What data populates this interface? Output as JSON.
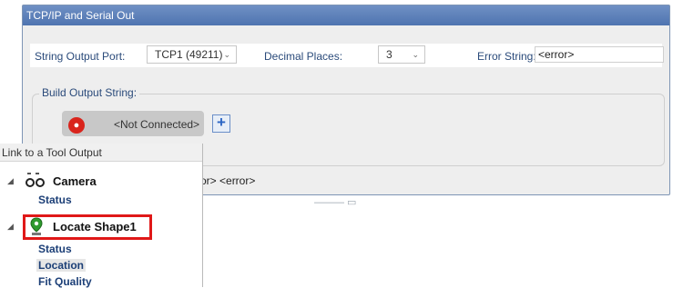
{
  "dialog": {
    "title": "TCP/IP and Serial Out",
    "string_output_port_label": "String Output Port:",
    "string_output_port_value": "TCP1 (49211)",
    "decimal_places_label": "Decimal Places:",
    "decimal_places_value": "3",
    "error_string_label": "Error String:",
    "error_string_value": "<error>",
    "build_output_label": "Build Output String:",
    "token_text": "<Not Connected>",
    "add_button": "+",
    "preview_text": "ror> <error>"
  },
  "popup": {
    "header": "Link to a Tool Output",
    "tree": [
      {
        "label": "Camera",
        "icon": "camera-icon",
        "children": [
          "Status"
        ]
      },
      {
        "label": "Locate Shape1",
        "icon": "location-pin-icon",
        "children": [
          "Status",
          "Location",
          "Fit Quality"
        ]
      }
    ],
    "selected_child": "Location"
  },
  "colors": {
    "titlebar": "#5b7fb9",
    "highlight": "#e01818",
    "plug_icon": "#d9241c",
    "link_text": "#1c3f77"
  }
}
